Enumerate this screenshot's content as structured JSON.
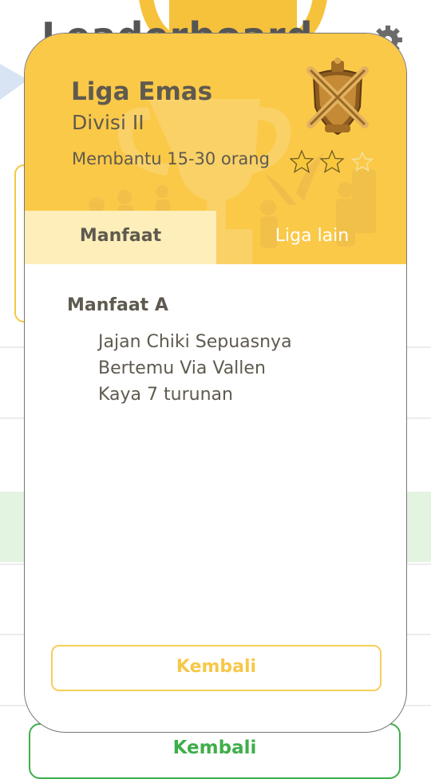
{
  "background": {
    "title": "Leaderboard",
    "back_label": "Kembali"
  },
  "modal": {
    "league_name": "Liga Emas",
    "division": "Divisi II",
    "helping_range": "Membantu 15-30 orang",
    "stars_filled": 2,
    "stars_total": 3,
    "tabs": [
      {
        "label": "Manfaat",
        "active": true
      },
      {
        "label": "Liga lain",
        "active": false
      }
    ],
    "section_title": "Manfaat A",
    "benefits": [
      "Jajan Chiki Sepuasnya",
      "Bertemu Via Vallen",
      "Kaya 7 turunan"
    ],
    "back_label": "Kembali"
  },
  "colors": {
    "header_yellow": "#fbc948",
    "active_tab": "#fdeeba",
    "text_dark": "#5f5a4f",
    "button_yellow": "#f6c84a",
    "button_green": "#3fae4a",
    "list_highlight_green": "#e3f4e1"
  },
  "icons": {
    "badge": "crossed-swords-badge-icon",
    "star": "star-icon",
    "gear": "gear-icon",
    "trophy": "trophy-icon"
  }
}
